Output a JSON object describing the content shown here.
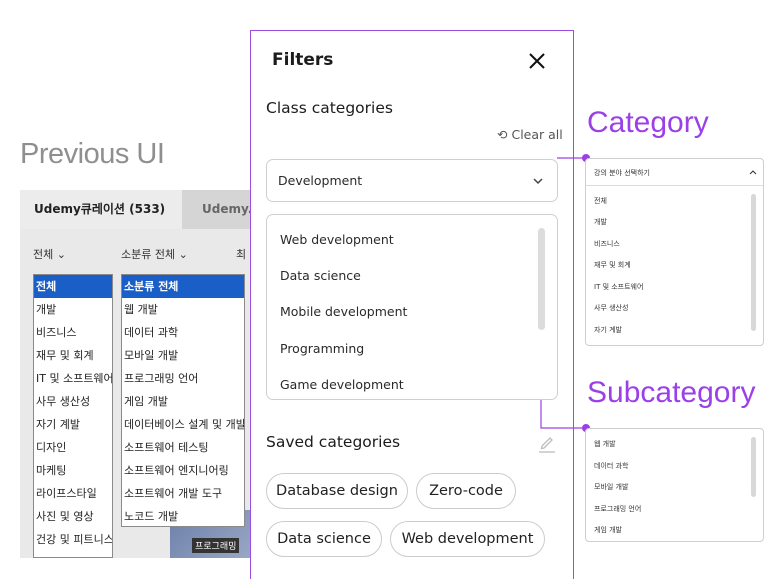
{
  "previous": {
    "title": "Previous UI",
    "tabs": [
      "Udemy큐레이션 (533)",
      "Udemy.c"
    ],
    "filters": [
      "전체",
      "소분류 전체",
      "최"
    ],
    "category_list": [
      "전체",
      "개발",
      "비즈니스",
      "재무 및 회계",
      "IT 및 소프트웨어",
      "사무 생산성",
      "자기 계발",
      "디자인",
      "마케팅",
      "라이프스타일",
      "사진 및 영상",
      "건강 및 피트니스"
    ],
    "subcategory_list": [
      "소분류 전체",
      "웹 개발",
      "데이터 과학",
      "모바일 개발",
      "프로그래밍 언어",
      "게임 개발",
      "데이터베이스 설계 및 개발",
      "소프트웨어 테스팅",
      "소프트웨어 엔지니어링",
      "소프트웨어 개발 도구",
      "노코드 개발"
    ],
    "media_label": "프로그래밍"
  },
  "panel": {
    "title": "Filters",
    "class_categories_title": "Class categories",
    "clear_all": "Clear all",
    "select_value": "Development",
    "subcategories": [
      "Web development",
      "Data science",
      "Mobile development",
      "Programming",
      "Game development"
    ],
    "saved_title": "Saved categories",
    "saved_chips": [
      "Database design",
      "Zero-code",
      "Data science",
      "Web development"
    ]
  },
  "annotations": {
    "category": "Category",
    "subcategory": "Subcategory"
  },
  "mini_category": {
    "header": "강의 분야 선택하기",
    "items": [
      "전체",
      "개발",
      "비즈니스",
      "재무 및 회계",
      "IT 및 소프트웨어",
      "사무 생산성",
      "자기 계발"
    ]
  },
  "mini_subcategory": {
    "items": [
      "웹 개발",
      "데이터 과학",
      "모바일 개발",
      "프로그래밍 언어",
      "게임 개발"
    ]
  },
  "colors": {
    "accent": "#9b40e8",
    "selection": "#1a5fc8"
  }
}
